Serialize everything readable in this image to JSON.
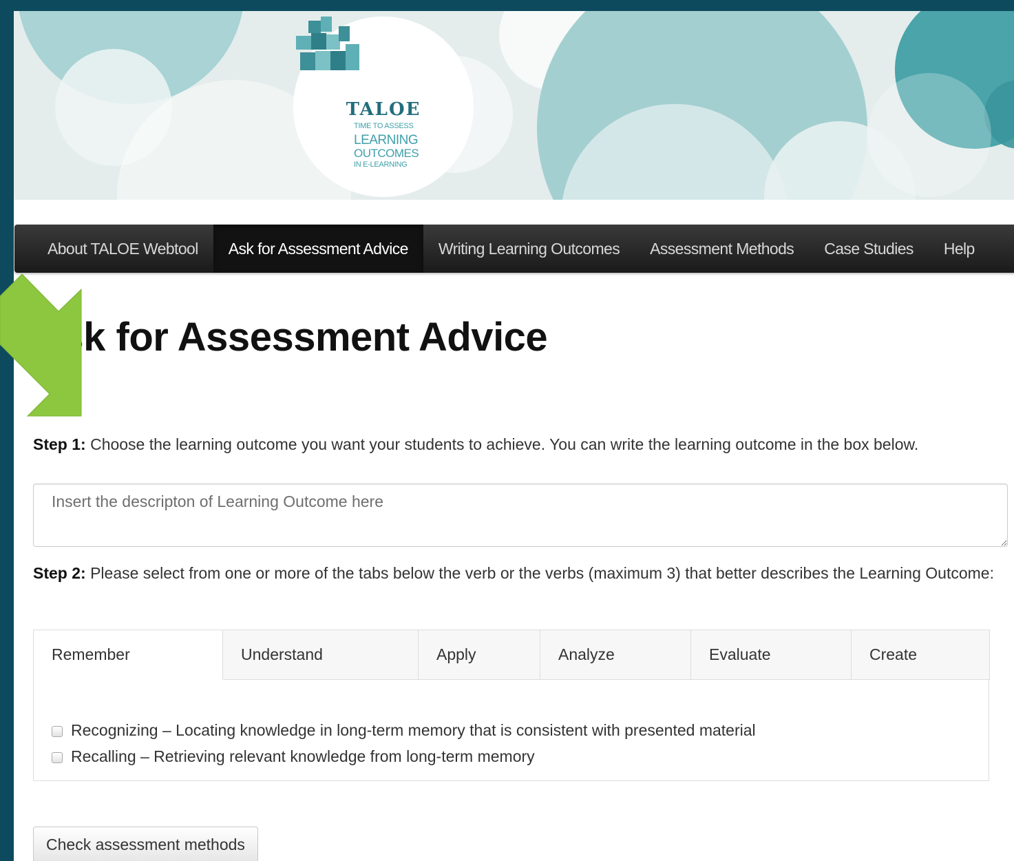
{
  "brand": {
    "logo_title": "TALOE",
    "logo_line1": "TIME TO ASSESS",
    "logo_line2": "LEARNING",
    "logo_line3": "OUTCOMES",
    "logo_line4": "IN E-LEARNING",
    "logo_icon": "stacked-cubes-icon",
    "accent_color": "#6fb7b9"
  },
  "nav": {
    "items": [
      {
        "label": "About TALOE Webtool",
        "active": false
      },
      {
        "label": "Ask for Assessment Advice",
        "active": true
      },
      {
        "label": "Writing Learning Outcomes",
        "active": false
      },
      {
        "label": "Assessment Methods",
        "active": false
      },
      {
        "label": "Case Studies",
        "active": false
      },
      {
        "label": "Help",
        "active": false
      }
    ]
  },
  "annotation": {
    "icon": "arrow-down-right-icon",
    "color": "#8dc63f"
  },
  "page": {
    "title": "Ask for Assessment Advice"
  },
  "step1": {
    "label": "Step 1:",
    "text": " Choose the learning outcome you want your students to achieve. You can write the learning outcome in the box below.",
    "input_value": "",
    "input_placeholder": "Insert the descripton of Learning Outcome here"
  },
  "step2": {
    "label": "Step 2:",
    "text": " Please select from one or more of the tabs below the verb or the verbs (maximum 3) that better describes the Learning Outcome:"
  },
  "tabs": {
    "items": [
      {
        "label": "Remember",
        "active": true
      },
      {
        "label": "Understand",
        "active": false
      },
      {
        "label": "Apply",
        "active": false
      },
      {
        "label": "Analyze",
        "active": false
      },
      {
        "label": "Evaluate",
        "active": false
      },
      {
        "label": "Create",
        "active": false
      }
    ]
  },
  "verbs": {
    "items": [
      {
        "label": "Recognizing – Locating knowledge in long-term memory that is consistent with presented material",
        "checked": false
      },
      {
        "label": "Recalling – Retrieving relevant knowledge from long-term memory",
        "checked": false
      }
    ]
  },
  "actions": {
    "check_label": "Check assessment methods"
  }
}
